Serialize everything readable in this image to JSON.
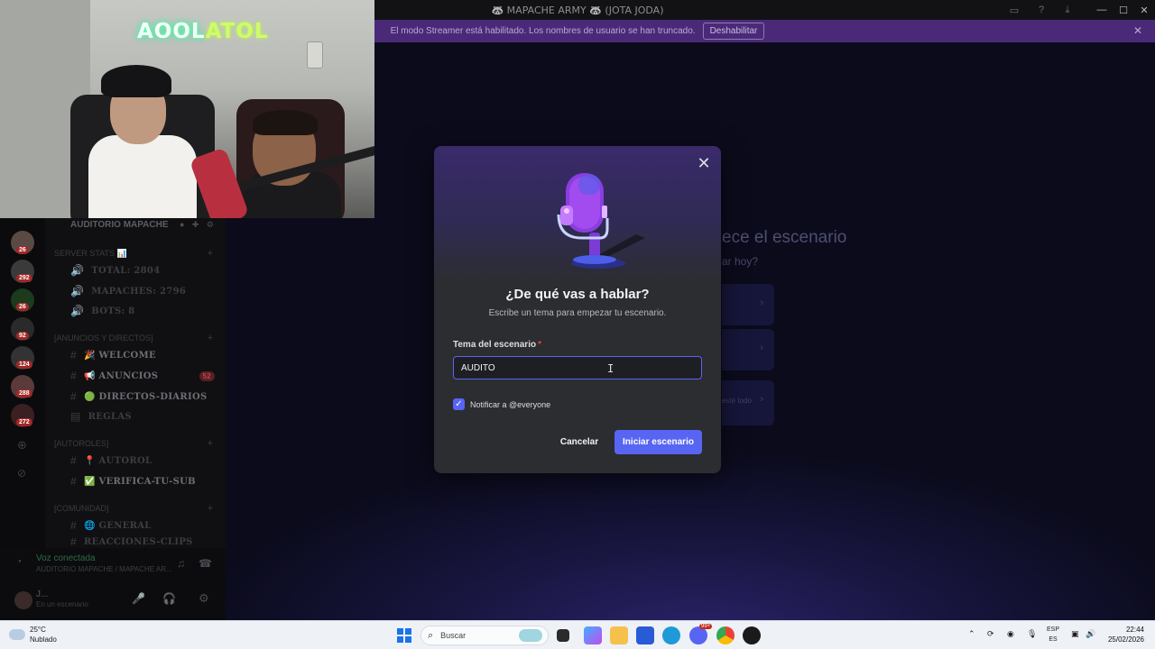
{
  "window": {
    "title": "🦝 MAPACHE ARMY 🦝 (JOTA JODA)"
  },
  "banner": {
    "text": "El modo Streamer está habilitado. Los nombres de usuario se han truncado.",
    "button": "Deshabilitar"
  },
  "background": {
    "heading": "ece el escenario",
    "sub": "ar hoy?",
    "card3_text": "esté todo"
  },
  "webcam": {
    "logo_a": "AOOL",
    "logo_b": "ATOL"
  },
  "server": {
    "name": "AUDITORIO MAPACHE",
    "badges": [
      "26",
      "292",
      "26",
      "92",
      "124",
      "288",
      "272"
    ],
    "channels": [
      {
        "label": "SERVER STATS 📊",
        "type": "category"
      },
      {
        "label": "TOTAL: 2804",
        "type": "voice"
      },
      {
        "label": "MAPACHES: 2796",
        "type": "voice"
      },
      {
        "label": "BOTS: 8",
        "type": "voice"
      },
      {
        "label": "[ANUNCIOS Y DIRECTOS]",
        "type": "category"
      },
      {
        "label": "🎉 WELCOME",
        "type": "text"
      },
      {
        "label": "📢 ANUNCIOS",
        "type": "text",
        "badge": "52"
      },
      {
        "label": "🟢 DIRECTOS-DIARIOS",
        "type": "text"
      },
      {
        "label": "REGLAS",
        "type": "rules"
      },
      {
        "label": "[AUTOROLES]",
        "type": "category"
      },
      {
        "label": "📍 AUTOROL",
        "type": "text"
      },
      {
        "label": "✅ VERIFICA-TU-SUB",
        "type": "text"
      },
      {
        "label": "[COMUNIDAD]",
        "type": "category"
      },
      {
        "label": "🌐 GENERAL",
        "type": "text"
      },
      {
        "label": "REACCIONES-CLIPS",
        "type": "text"
      }
    ]
  },
  "voice": {
    "status": "Voz conectada",
    "channel": "AUDITORIO MAPACHE / MAPACHE AR..."
  },
  "user": {
    "name": "J...",
    "status": "En un escenario"
  },
  "modal": {
    "title": "¿De qué vas a hablar?",
    "subtitle": "Escribe un tema para empezar tu escenario.",
    "field_label": "Tema del escenario",
    "required_mark": "*",
    "topic_value": "AUDITO",
    "notify_label": "Notificar a @everyone",
    "notify_checked": true,
    "cancel": "Cancelar",
    "start": "Iniciar escenario"
  },
  "taskbar": {
    "temperature": "25°C",
    "weather": "Nublado",
    "search": "Buscar",
    "lang_top": "ESP",
    "lang_bottom": "ES",
    "time": "22:44",
    "date": "25/02/2026",
    "notif_badge": "99+"
  },
  "colors": {
    "accent": "#5865f2",
    "modal_bg": "#2b2d31",
    "banner": "#4a2a78",
    "required": "#f23f43"
  }
}
